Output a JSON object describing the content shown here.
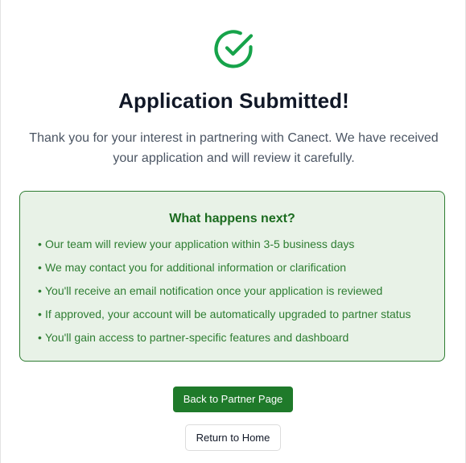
{
  "icon": {
    "name": "check-circle-icon",
    "color": "#16a34a"
  },
  "title": "Application Submitted!",
  "message": "Thank you for your interest in partnering with Canect. We have received your application and will review it carefully.",
  "next_steps": {
    "title": "What happens next?",
    "bullet": "•",
    "items": [
      "Our team will review your application within 3-5 business days",
      "We may contact you for additional information or clarification",
      "You'll receive an email notification once your application is reviewed",
      "If approved, your account will be automatically upgraded to partner status",
      "You'll gain access to partner-specific features and dashboard"
    ],
    "background_color": "#e8f2e7",
    "border_color": "#2e7d32",
    "text_color": "#2e7d32"
  },
  "actions": {
    "primary_label": "Back to Partner Page",
    "primary_color": "#1f7a2a",
    "secondary_label": "Return to Home"
  }
}
